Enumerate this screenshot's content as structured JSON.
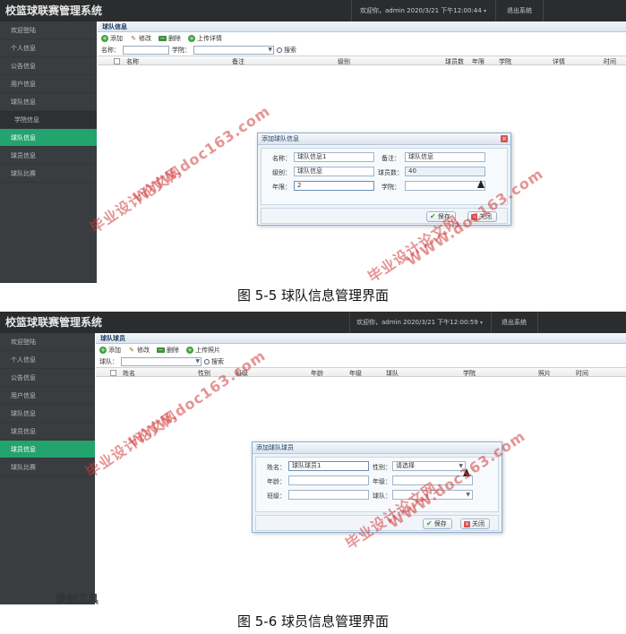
{
  "colors": {
    "accent": "#23a46f",
    "topbar": "#2a2c2e",
    "sidebar": "#3a3d40"
  },
  "shot1": {
    "app_title": "校篮球联赛管理系统",
    "welcome": "欢迎你，admin  2020/3/21 下午12:00:44",
    "logout": "退出系统",
    "menu": [
      {
        "label": "欢迎登陆"
      },
      {
        "label": "个人信息"
      },
      {
        "label": "公告信息"
      },
      {
        "label": "用户信息"
      },
      {
        "label": "球队信息"
      },
      {
        "label": "学院信息"
      },
      {
        "label": "球队信息"
      },
      {
        "label": "球员信息"
      },
      {
        "label": "球队比赛"
      }
    ],
    "panel_title": "球队信息",
    "toolbar": {
      "add": "添加",
      "edit": "修改",
      "delete": "删除",
      "upload": "上传详情"
    },
    "filter": {
      "name_label": "名称：",
      "college_label": "学院：",
      "search": "搜索"
    },
    "columns": [
      "名称",
      "备注",
      "级别",
      "球员数",
      "年限",
      "学院",
      "详情",
      "时间"
    ],
    "dialog": {
      "title": "添加球队信息",
      "name_label": "名称：",
      "name_value": "球队信息1",
      "remark_label": "备注：",
      "remark_value": "球队信息",
      "level_label": "级别：",
      "level_value": "球队信息",
      "players_label": "球员数：",
      "players_value": "40",
      "years_label": "年限：",
      "years_value": "2",
      "college_label": "学院：",
      "college_value": "",
      "save": "保存",
      "close": "关闭"
    },
    "watermark": "WWW.doc163.com",
    "watermark2": "毕业设计论文网"
  },
  "caption1": "图 5-5 球队信息管理界面",
  "shot2": {
    "app_title": "校篮球联赛管理系统",
    "welcome": "欢迎你，admin  2020/3/21 下午12:00:59",
    "logout": "退出系统",
    "menu": [
      {
        "label": "欢迎登陆"
      },
      {
        "label": "个人信息"
      },
      {
        "label": "公告信息"
      },
      {
        "label": "用户信息"
      },
      {
        "label": "球队信息"
      },
      {
        "label": "球员信息"
      },
      {
        "label": "球员信息"
      },
      {
        "label": "球队比赛"
      }
    ],
    "panel_title": "球队球员",
    "toolbar": {
      "add": "添加",
      "edit": "修改",
      "delete": "删除",
      "upload": "上传照片"
    },
    "filter": {
      "team_label": "球队：",
      "search": "搜索"
    },
    "columns": [
      "姓名",
      "性别",
      "班级",
      "年龄",
      "年级",
      "球队",
      "学院",
      "照片",
      "时间"
    ],
    "dialog": {
      "title": "添加球队球员",
      "name_label": "姓名：",
      "name_value": "球队球员1",
      "gender_label": "性别：",
      "gender_value": "请选择",
      "age_label": "年龄：",
      "age_value": "",
      "grade_label": "年级：",
      "grade_value": "",
      "class_label": "班级：",
      "class_value": "",
      "team_label": "球队：",
      "team_value": "",
      "save": "保存",
      "close": "关闭"
    },
    "watermark": "WWW.doc163.com",
    "watermark2": "毕业设计论文网",
    "rec_mark": "录制工具"
  },
  "caption2": "图 5-6 球员信息管理界面"
}
